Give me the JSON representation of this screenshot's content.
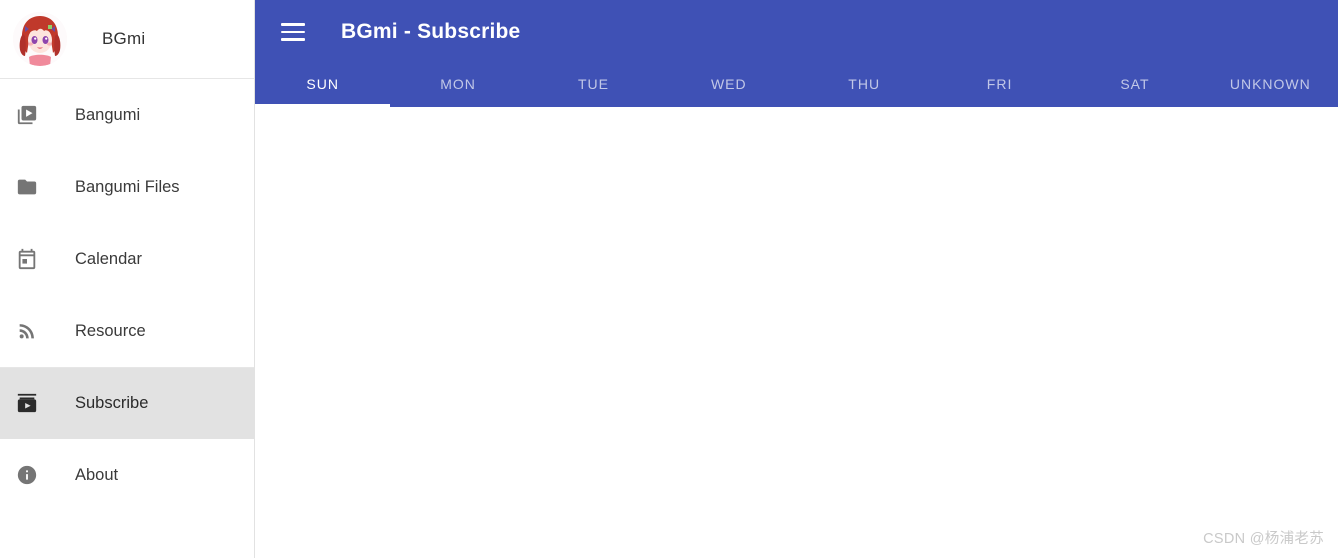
{
  "sidebar": {
    "brand": {
      "name": "BGmi",
      "avatar_icon": "anime-avatar"
    },
    "items": [
      {
        "label": "Bangumi",
        "icon": "video-library-icon",
        "active": false
      },
      {
        "label": "Bangumi Files",
        "icon": "folder-icon",
        "active": false
      },
      {
        "label": "Calendar",
        "icon": "calendar-icon",
        "active": false
      },
      {
        "label": "Resource",
        "icon": "rss-icon",
        "active": false
      },
      {
        "label": "Subscribe",
        "icon": "subscriptions-icon",
        "active": true
      },
      {
        "label": "About",
        "icon": "info-circle-icon",
        "active": false
      }
    ]
  },
  "appbar": {
    "menu_icon": "hamburger-menu-icon",
    "title": "BGmi - Subscribe",
    "background_color": "#3f51b5"
  },
  "tabs": {
    "active_index": 0,
    "items": [
      {
        "label": "SUN"
      },
      {
        "label": "MON"
      },
      {
        "label": "TUE"
      },
      {
        "label": "WED"
      },
      {
        "label": "THU"
      },
      {
        "label": "FRI"
      },
      {
        "label": "SAT"
      },
      {
        "label": "UNKNOWN"
      }
    ]
  },
  "content": {
    "body_text": "",
    "watermark": "CSDN @杨浦老苏"
  }
}
